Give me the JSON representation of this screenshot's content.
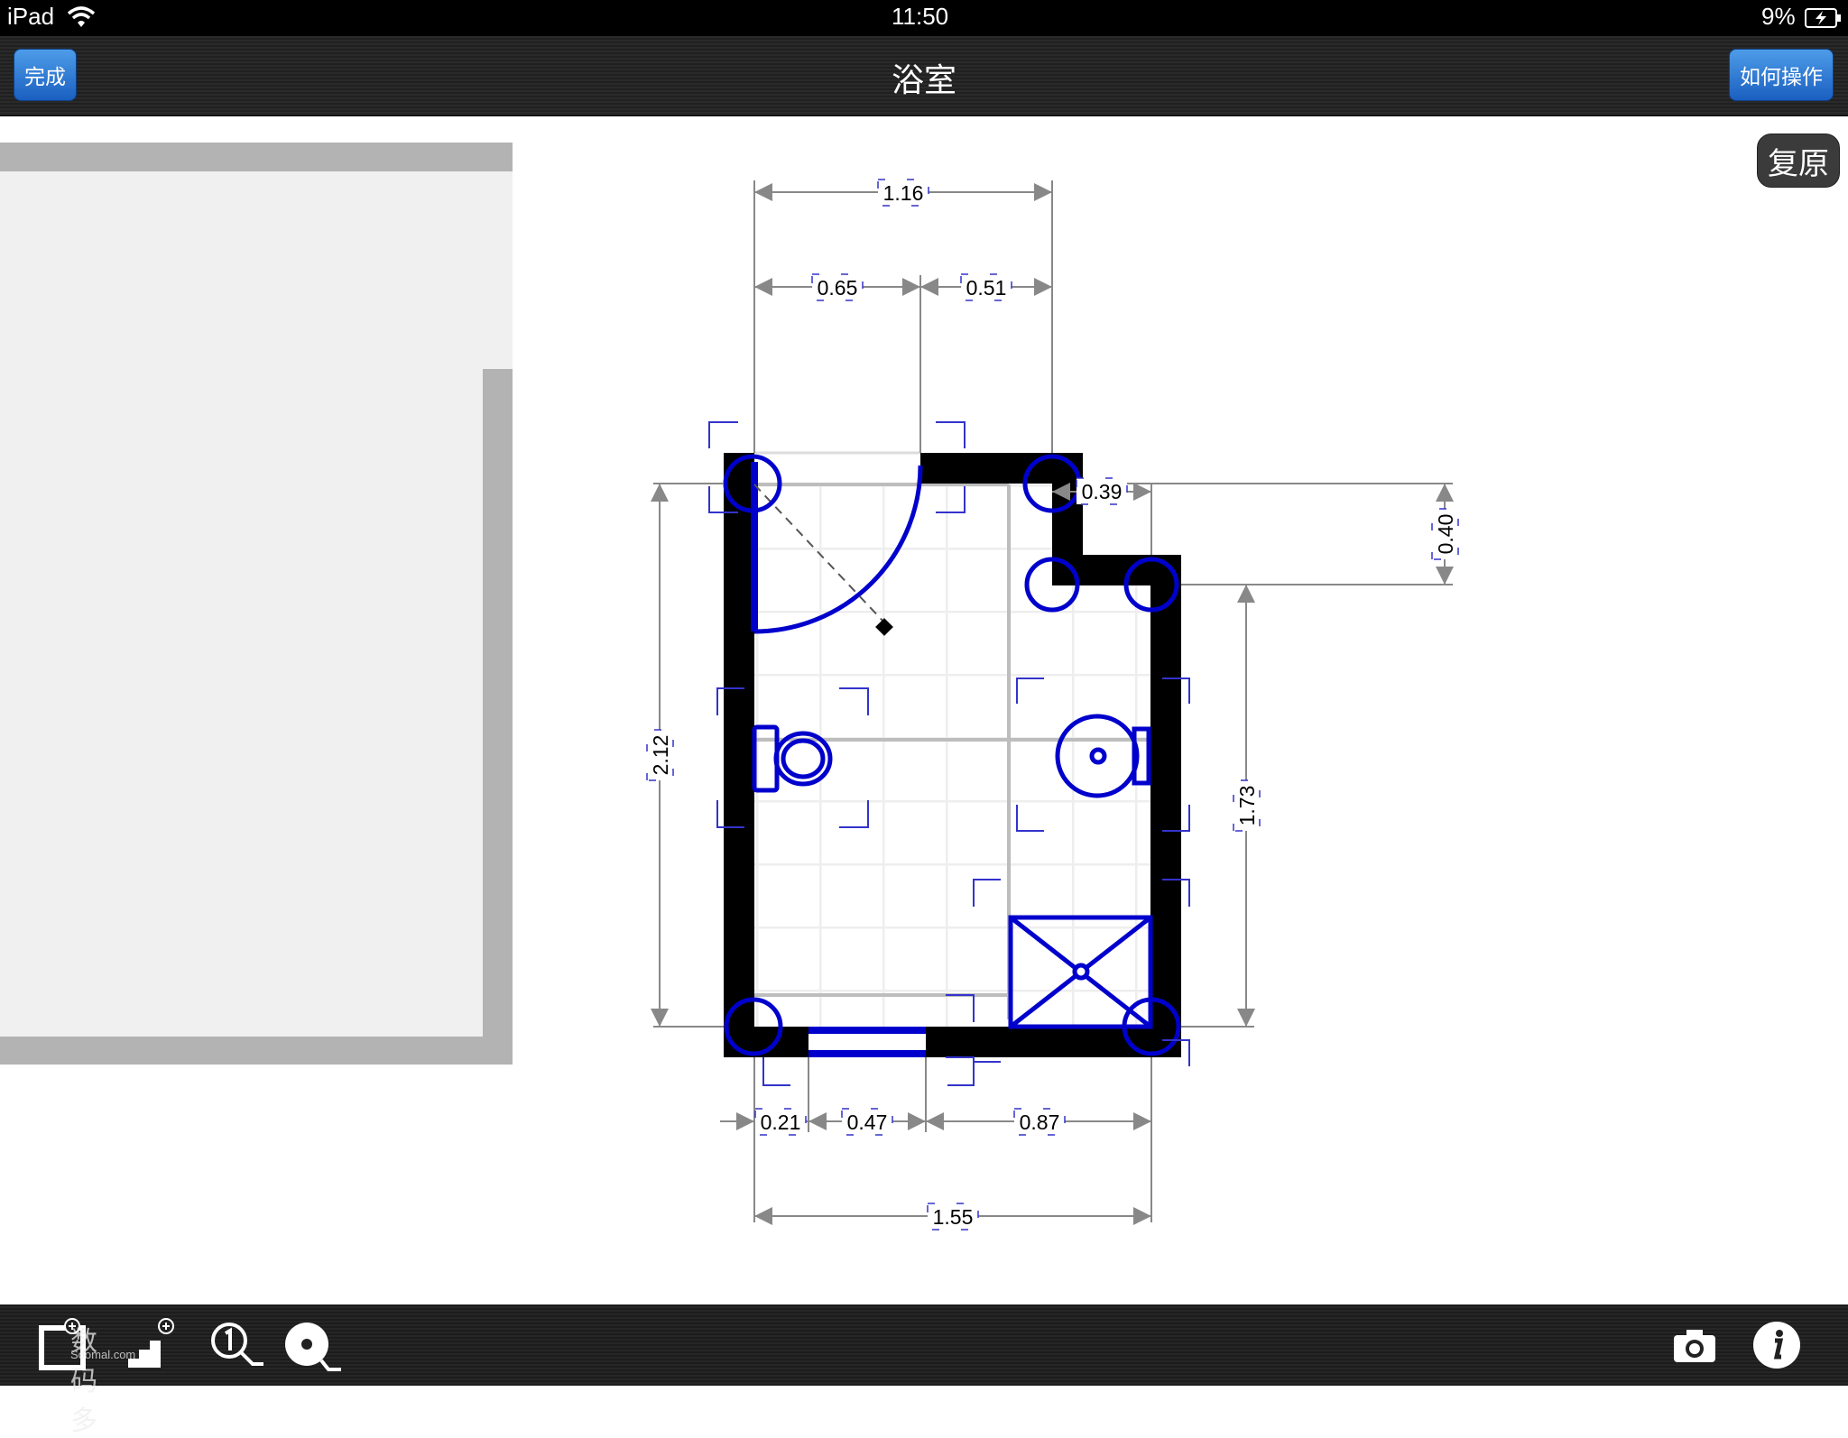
{
  "status_bar": {
    "device": "iPad",
    "time": "11:50",
    "battery": "9%"
  },
  "nav": {
    "done_label": "完成",
    "title": "浴室",
    "howto_label": "如何操作"
  },
  "canvas": {
    "restore_label": "复原"
  },
  "floorplan": {
    "dimensions": {
      "top_total": "1.16",
      "top_left": "0.65",
      "top_right": "0.51",
      "step_width": "0.39",
      "step_height": "0.40",
      "left_height": "2.12",
      "right_height": "1.73",
      "bottom_a": "0.21",
      "bottom_b": "0.47",
      "bottom_c": "0.87",
      "bottom_total": "1.55"
    }
  },
  "watermark": {
    "text": "数码多",
    "sub": "Soomal.com"
  },
  "colors": {
    "wall": "#000000",
    "fixture": "#0000cc",
    "dimension": "#888888",
    "adjacent_room": "#b3b3b3"
  }
}
